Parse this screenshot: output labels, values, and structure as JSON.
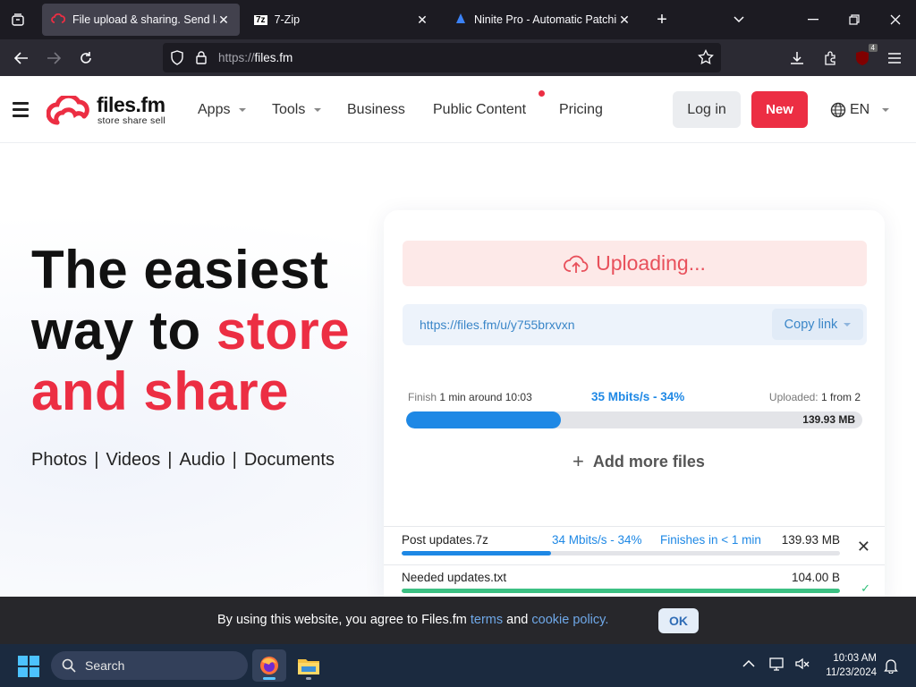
{
  "browser": {
    "tabs": [
      {
        "title": "File upload & sharing. Send large",
        "active": true
      },
      {
        "title": "7-Zip",
        "active": false
      },
      {
        "title": "Ninite Pro - Automatic Patching",
        "active": false
      }
    ],
    "url_scheme": "https://",
    "url_host": "files.fm",
    "downloads_badge": "4"
  },
  "site": {
    "logo_name": "files.fm",
    "logo_tagline": "store  share  sell",
    "nav": {
      "apps": "Apps",
      "tools": "Tools",
      "business": "Business",
      "public_content": "Public Content",
      "pricing": "Pricing"
    },
    "login": "Log in",
    "new": "New",
    "lang": "EN"
  },
  "hero": {
    "line1": "The easiest",
    "line2a": "way to ",
    "line2b": "store",
    "line3": "and share",
    "links": [
      "Photos",
      "Videos",
      "Audio",
      "Documents"
    ],
    "sep": "|"
  },
  "upload": {
    "status": "Uploading...",
    "link": "https://files.fm/u/y755brxvxn",
    "copy_label": "Copy link",
    "finish_label": "Finish",
    "finish_value": "1 min around 10:03",
    "speed": "35 Mbits/s - 34%",
    "uploaded_label": "Uploaded:",
    "uploaded_value": "1 from 2",
    "progress": 0.34,
    "total_size": "139.93 MB",
    "add_more": "Add more files",
    "files": [
      {
        "name": "Post updates.7z",
        "speed": "34 Mbits/s - 34%",
        "finish": "Finishes in < 1 min",
        "size": "139.93 MB",
        "progress": 0.34,
        "color": "#1e88e5"
      },
      {
        "name": "Needed updates.txt",
        "speed": "",
        "finish": "",
        "size": "104.00 B",
        "progress": 1.0,
        "color": "#3cc083"
      }
    ]
  },
  "cookie": {
    "text_before": "By using this website, you agree to Files.fm ",
    "terms": "terms",
    "and": " and ",
    "policy": "cookie policy.",
    "ok": "OK"
  },
  "taskbar": {
    "search_placeholder": "Search",
    "time": "10:03 AM",
    "date": "11/23/2024"
  },
  "colors": {
    "brand_red": "#ec2e43",
    "link_blue": "#1e88e5",
    "success_green": "#3cc083"
  }
}
